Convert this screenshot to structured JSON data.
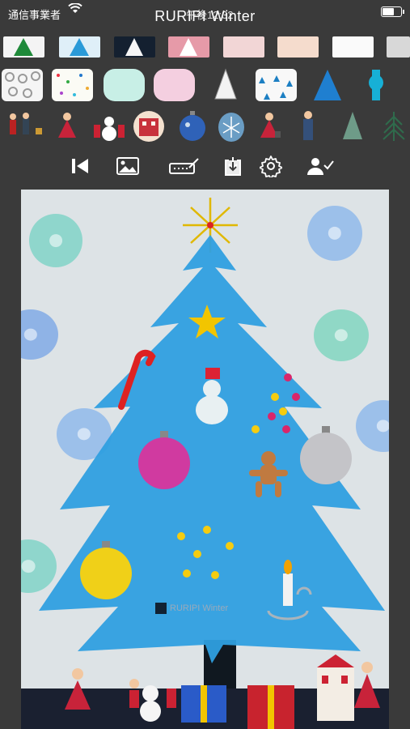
{
  "status": {
    "carrier": "通信事業者",
    "time": "午後12:32"
  },
  "app": {
    "title": "RURIPI Winter"
  },
  "toolbar": {
    "items": [
      {
        "name": "back-to-start-icon"
      },
      {
        "name": "image-icon"
      },
      {
        "name": "signature-icon"
      },
      {
        "name": "save-download-icon"
      },
      {
        "name": "gear-icon"
      },
      {
        "name": "user-check-icon"
      }
    ]
  },
  "watermark": {
    "text": "RURIPI Winter"
  },
  "colors": {
    "background": "#3a3a3a",
    "canvas": "#dde3e6",
    "tree": "#2f9fe0",
    "star": "#f2c500"
  }
}
